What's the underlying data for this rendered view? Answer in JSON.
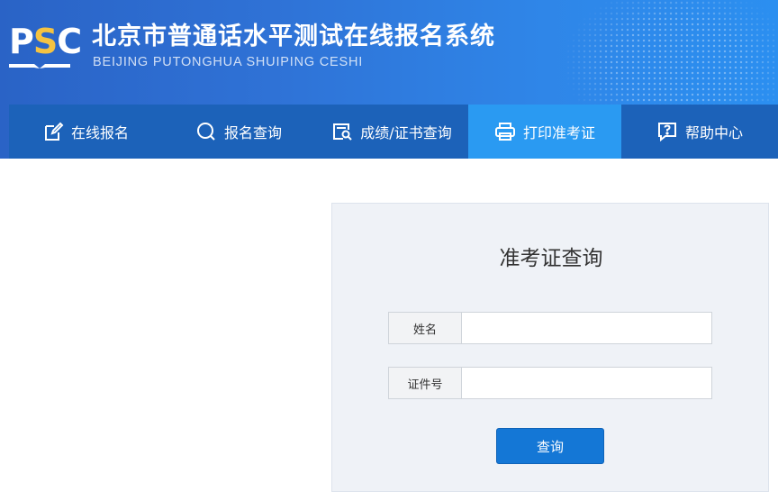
{
  "header": {
    "logo_text_p": "P",
    "logo_text_s": "S",
    "logo_text_c": "C",
    "title": "北京市普通话水平测试在线报名系统",
    "subtitle": "BEIJING PUTONGHUA SHUIPING CESHI"
  },
  "nav": {
    "items": [
      {
        "label": "在线报名",
        "icon": "edit-icon",
        "active": false
      },
      {
        "label": "报名查询",
        "icon": "search-icon",
        "active": false
      },
      {
        "label": "成绩/证书查询",
        "icon": "certificate-search-icon",
        "active": false
      },
      {
        "label": "打印准考证",
        "icon": "printer-icon",
        "active": true
      },
      {
        "label": "帮助中心",
        "icon": "help-icon",
        "active": false
      }
    ]
  },
  "query": {
    "title": "准考证查询",
    "name_label": "姓名",
    "name_value": "",
    "id_label": "证件号",
    "id_value": "",
    "submit_label": "查询"
  },
  "colors": {
    "header_bg": "#2f72d6",
    "nav_bg": "#1c62b9",
    "nav_active": "#2a9af2",
    "logo_accent": "#f5c342",
    "button": "#1477d6",
    "panel_bg": "#eff2f7"
  }
}
